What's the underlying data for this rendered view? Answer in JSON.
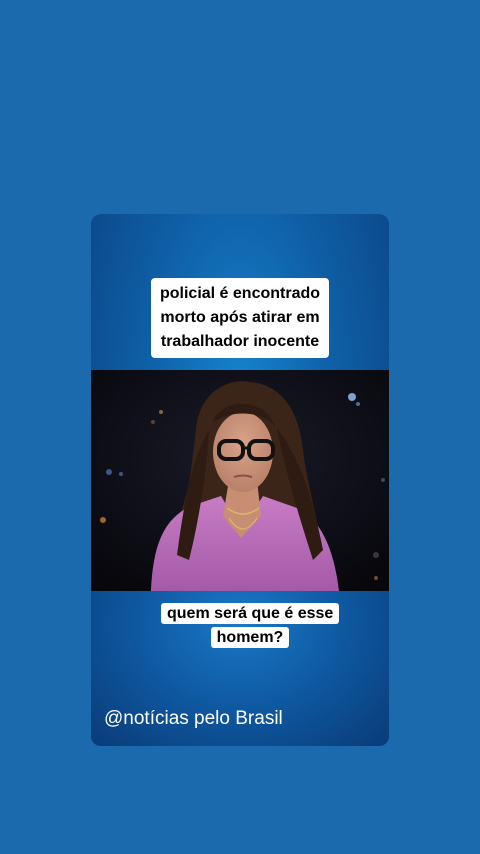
{
  "post": {
    "headline": "policial é encontrado morto após atirar em trabalhador inocente",
    "question": "quem será que é esse homem?",
    "watermark": "@notícias pelo Brasil"
  },
  "photo": {
    "subject": "woman-with-glasses-portrait"
  },
  "colors": {
    "background": "#1b6aad",
    "card_center": "#1684cf",
    "card_edge": "#0a3f7e",
    "caption_bg": "#ffffff",
    "caption_text": "#000000"
  }
}
